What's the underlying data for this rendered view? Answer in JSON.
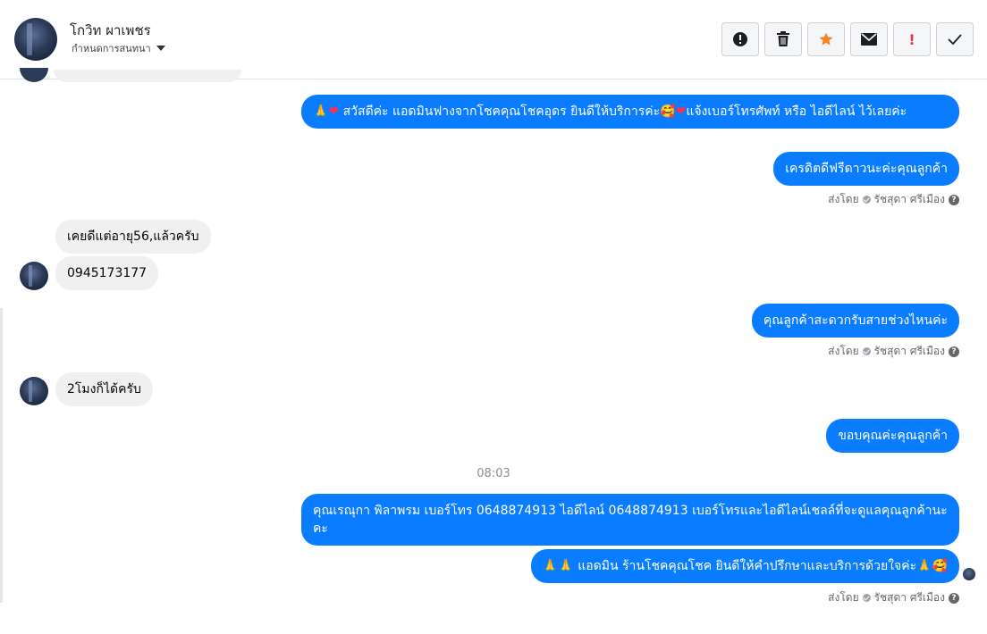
{
  "header": {
    "contact_name": "โกวิท ผาเพชร",
    "assign_label": "กำหนดการสนทนา"
  },
  "toolbar": {
    "mark_unread_icon": "alert-circle-icon",
    "delete_icon": "trash-icon",
    "star_icon": "star-icon",
    "email_icon": "envelope-icon",
    "spam_icon": "exclamation-icon",
    "spam_label": "!",
    "done_icon": "check-icon"
  },
  "colors": {
    "outgoing_bubble": "#0a7cff",
    "incoming_bubble": "#f0f0f0",
    "star": "#f5821f",
    "spam": "#e4324c"
  },
  "messages": {
    "m1": {
      "pre": "🙏",
      "heart1": "❤",
      "text1": " สวัสดีค่ะ แอดมินฟางจากโชคคุณโชคอุดร ยินดีให้บริการค่ะ",
      "face": "🥰",
      "heart2": "❤",
      "text2": "แจ้งเบอร์โทรศัพท์ หรือ ไอดีไลน์  ไว้เลยค่ะ"
    },
    "m2": "เครดิตดีฟรีดาวนะค่ะคุณลูกค้า",
    "sent_by_1": "ส่งโดย",
    "sender_1": "รัชสุดา ศรีเมือง",
    "m3": "เคยดีแต่อายุ56,แล้วครับ",
    "m4": "0945173177",
    "m5": "คุณลูกค้าสะดวกรับสายช่วงไหนค่ะ",
    "sent_by_2": "ส่งโดย",
    "sender_2": "รัชสุดา ศรีเมือง",
    "m6": "2โมงก็ได้ครับ",
    "m7": "ขอบคุณค่ะคุณลูกค้า",
    "time": "08:03",
    "m8": "คุณเรณุกา พิลาพรม        เบอร์โทร 0648874913  ไอดีไลน์ 0648874913   เบอร์โทรและไอดีไลน์เชลล์ที่จะดูแลคุณลูกค้านะคะ",
    "m9": {
      "pre": "🙏🙏",
      "text": "แอดมิน ร้านโชคคุณโชค ยินดีให้คำปรึกษาและบริการด้วยใจค่ะ",
      "post": "🙏",
      "face": "🥰"
    },
    "sent_by_3": "ส่งโดย",
    "sender_3": "รัชสุดา ศรีเมือง"
  }
}
